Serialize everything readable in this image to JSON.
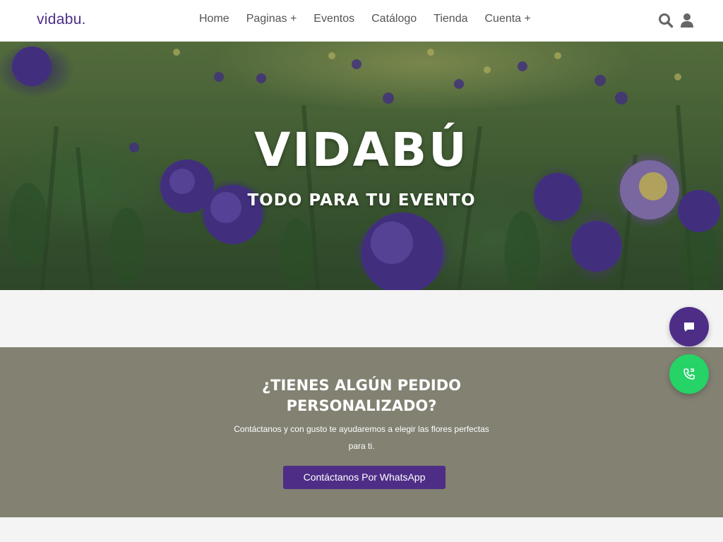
{
  "header": {
    "logo": "vidabu.",
    "nav": [
      "Home",
      "Paginas +",
      "Eventos",
      "Catálogo",
      "Tienda",
      "Cuenta +"
    ],
    "icons": [
      "search-icon",
      "user-icon"
    ]
  },
  "hero": {
    "title": "VIDABÚ",
    "subtitle": "TODO PARA TU EVENTO"
  },
  "cta": {
    "title_line1": "¿TIENES ALGÚN PEDIDO",
    "title_line2": "PERSONALIZADO?",
    "text_line1": "Contáctanos y con gusto te ayudaremos a elegir las flores perfectas",
    "text_line2": "para ti.",
    "button_label": "Contáctanos Por WhatsApp"
  },
  "floating": {
    "chat_icon": "chat-icon",
    "phone_icon": "phone-icon"
  },
  "colors": {
    "brand": "#4e2d87",
    "cta_bg": "#828172",
    "whatsapp": "#25d366"
  }
}
